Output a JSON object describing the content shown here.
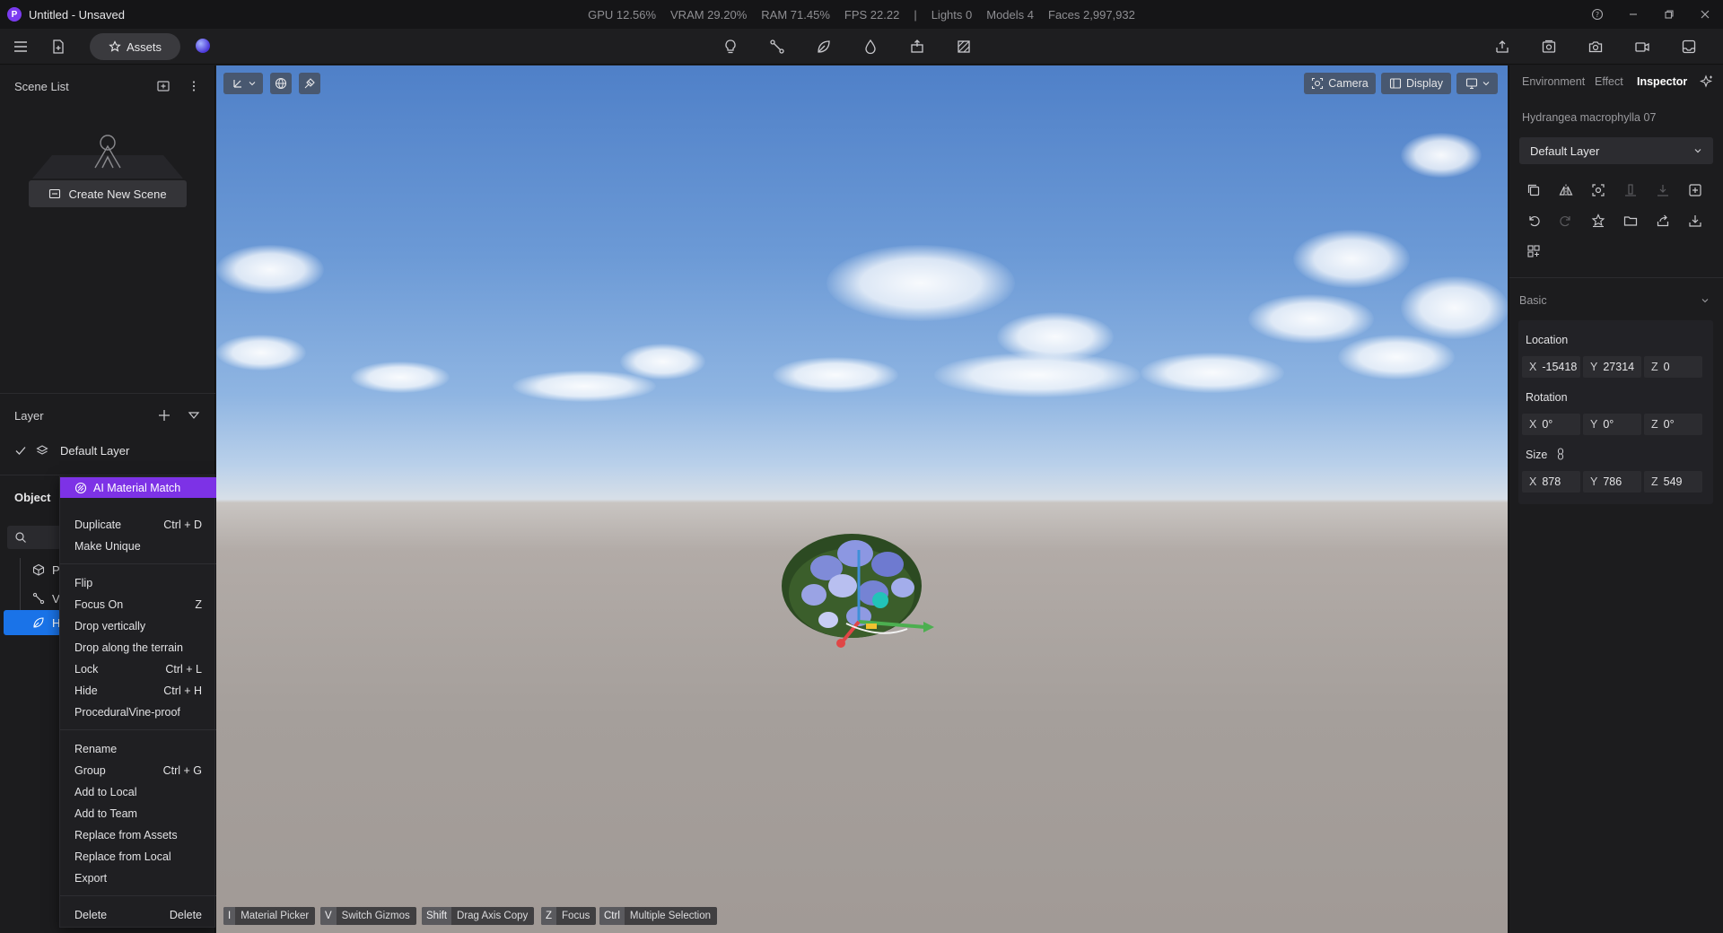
{
  "titlebar": {
    "title": "Untitled - Unsaved",
    "stats": {
      "gpu": "GPU 12.56%",
      "vram": "VRAM 29.20%",
      "ram": "RAM 71.45%",
      "fps": "FPS 22.22",
      "separator": "|",
      "lights": "Lights 0",
      "models": "Models 4",
      "faces": "Faces 2,997,932"
    }
  },
  "toolbar": {
    "assets_label": "Assets"
  },
  "left_panel": {
    "scene_list_title": "Scene List",
    "create_scene_label": "Create New Scene",
    "layer_title": "Layer",
    "default_layer": "Default Layer",
    "object_title": "Object",
    "tree_items": [
      "P",
      "V",
      "H"
    ]
  },
  "context_menu": {
    "ai_match": "AI Material Match",
    "items": [
      {
        "label": "Duplicate",
        "shortcut": "Ctrl + D"
      },
      {
        "label": "Make Unique",
        "shortcut": ""
      },
      {
        "label": "Flip",
        "shortcut": ""
      },
      {
        "label": "Focus On",
        "shortcut": "Z"
      },
      {
        "label": "Drop vertically",
        "shortcut": ""
      },
      {
        "label": "Drop along the terrain",
        "shortcut": ""
      },
      {
        "label": "Lock",
        "shortcut": "Ctrl + L"
      },
      {
        "label": "Hide",
        "shortcut": "Ctrl + H"
      },
      {
        "label": "ProceduralVine-proof",
        "shortcut": ""
      },
      {
        "label": "Rename",
        "shortcut": ""
      },
      {
        "label": "Group",
        "shortcut": "Ctrl + G"
      },
      {
        "label": "Add to Local",
        "shortcut": ""
      },
      {
        "label": "Add to Team",
        "shortcut": ""
      },
      {
        "label": "Replace from Assets",
        "shortcut": ""
      },
      {
        "label": "Replace from Local",
        "shortcut": ""
      },
      {
        "label": "Export",
        "shortcut": ""
      },
      {
        "label": "Delete",
        "shortcut": "Delete"
      }
    ]
  },
  "viewport": {
    "camera_label": "Camera",
    "display_label": "Display",
    "hints": [
      {
        "key": "I",
        "label": "Material Picker"
      },
      {
        "key": "V",
        "label": "Switch Gizmos"
      },
      {
        "key": "Shift",
        "label": "Drag Axis Copy"
      },
      {
        "key": "Z",
        "label": "Focus"
      },
      {
        "key": "Ctrl",
        "label": "Multiple Selection"
      }
    ]
  },
  "right_panel": {
    "tabs": [
      "Environment",
      "Effect",
      "Inspector"
    ],
    "active_tab": "Inspector",
    "object_name": "Hydrangea macrophylla 07",
    "layer_value": "Default Layer",
    "basic_title": "Basic",
    "location_label": "Location",
    "rotation_label": "Rotation",
    "size_label": "Size",
    "location": {
      "x": "-15418",
      "y": "27314",
      "z": "0"
    },
    "rotation": {
      "x": "0°",
      "y": "0°",
      "z": "0°"
    },
    "size": {
      "x": "878",
      "y": "786",
      "z": "549"
    },
    "axes": {
      "x": "X",
      "y": "Y",
      "z": "Z"
    }
  },
  "colors": {
    "accent_purple": "#7d32e6",
    "selected_blue": "#1a73e8",
    "background": "#1c1c1e"
  }
}
